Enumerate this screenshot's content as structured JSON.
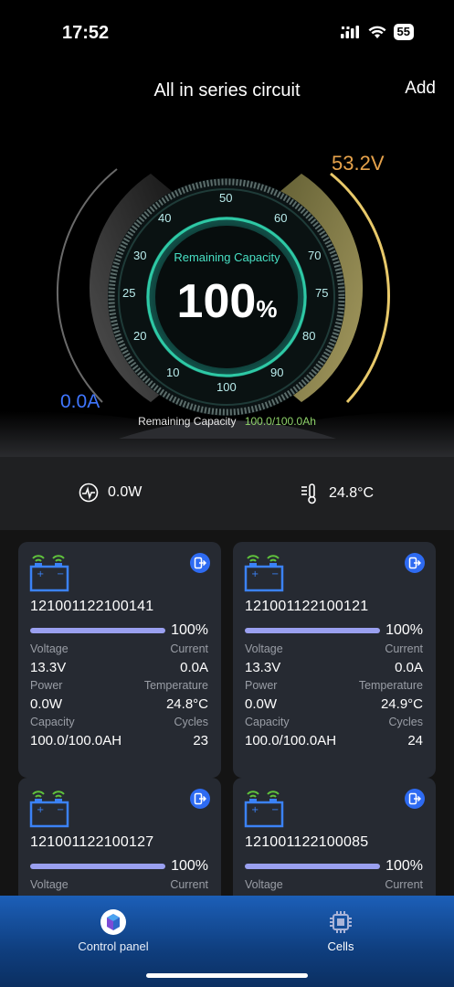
{
  "status": {
    "time": "17:52",
    "battery": "55"
  },
  "header": {
    "title": "All in series circuit",
    "add_label": "Add"
  },
  "gauge": {
    "voltage": "53.2V",
    "current": "0.0A",
    "label": "Remaining Capacity",
    "value": "100",
    "unit": "%",
    "ticks": [
      "10",
      "20",
      "25",
      "30",
      "40",
      "50",
      "60",
      "70",
      "75",
      "80",
      "90",
      "100"
    ],
    "capacity_label": "Remaining Capacity",
    "capacity_value": "100.0/100.0Ah",
    "colors": {
      "voltage": "#e6a24b",
      "current": "#3f76ff",
      "ring": "#2ec9a5"
    }
  },
  "stats": {
    "power": "0.0W",
    "temperature": "24.8°C",
    "power_icon": "pulse-icon",
    "temp_icon": "thermometer-icon"
  },
  "cards": [
    {
      "id": "121001122100141",
      "percent": "100%",
      "level": 1.0,
      "voltage_label": "Voltage",
      "current_label": "Current",
      "voltage": "13.3V",
      "current": "0.0A",
      "power_label": "Power",
      "temperature_label": "Temperature",
      "power": "0.0W",
      "temperature": "24.8°C",
      "capacity_label": "Capacity",
      "cycles_label": "Cycles",
      "capacity": "100.0/100.0AH",
      "cycles": "23"
    },
    {
      "id": "121001122100121",
      "percent": "100%",
      "level": 1.0,
      "voltage_label": "Voltage",
      "current_label": "Current",
      "voltage": "13.3V",
      "current": "0.0A",
      "power_label": "Power",
      "temperature_label": "Temperature",
      "power": "0.0W",
      "temperature": "24.9°C",
      "capacity_label": "Capacity",
      "cycles_label": "Cycles",
      "capacity": "100.0/100.0AH",
      "cycles": "24"
    },
    {
      "id": "121001122100127",
      "percent": "100%",
      "level": 1.0,
      "voltage_label": "Voltage",
      "current_label": "Current"
    },
    {
      "id": "121001122100085",
      "percent": "100%",
      "level": 1.0,
      "voltage_label": "Voltage",
      "current_label": "Current"
    }
  ],
  "tabs": [
    {
      "label": "Control panel",
      "icon": "control-panel-icon"
    },
    {
      "label": "Cells",
      "icon": "cells-chip-icon"
    }
  ]
}
